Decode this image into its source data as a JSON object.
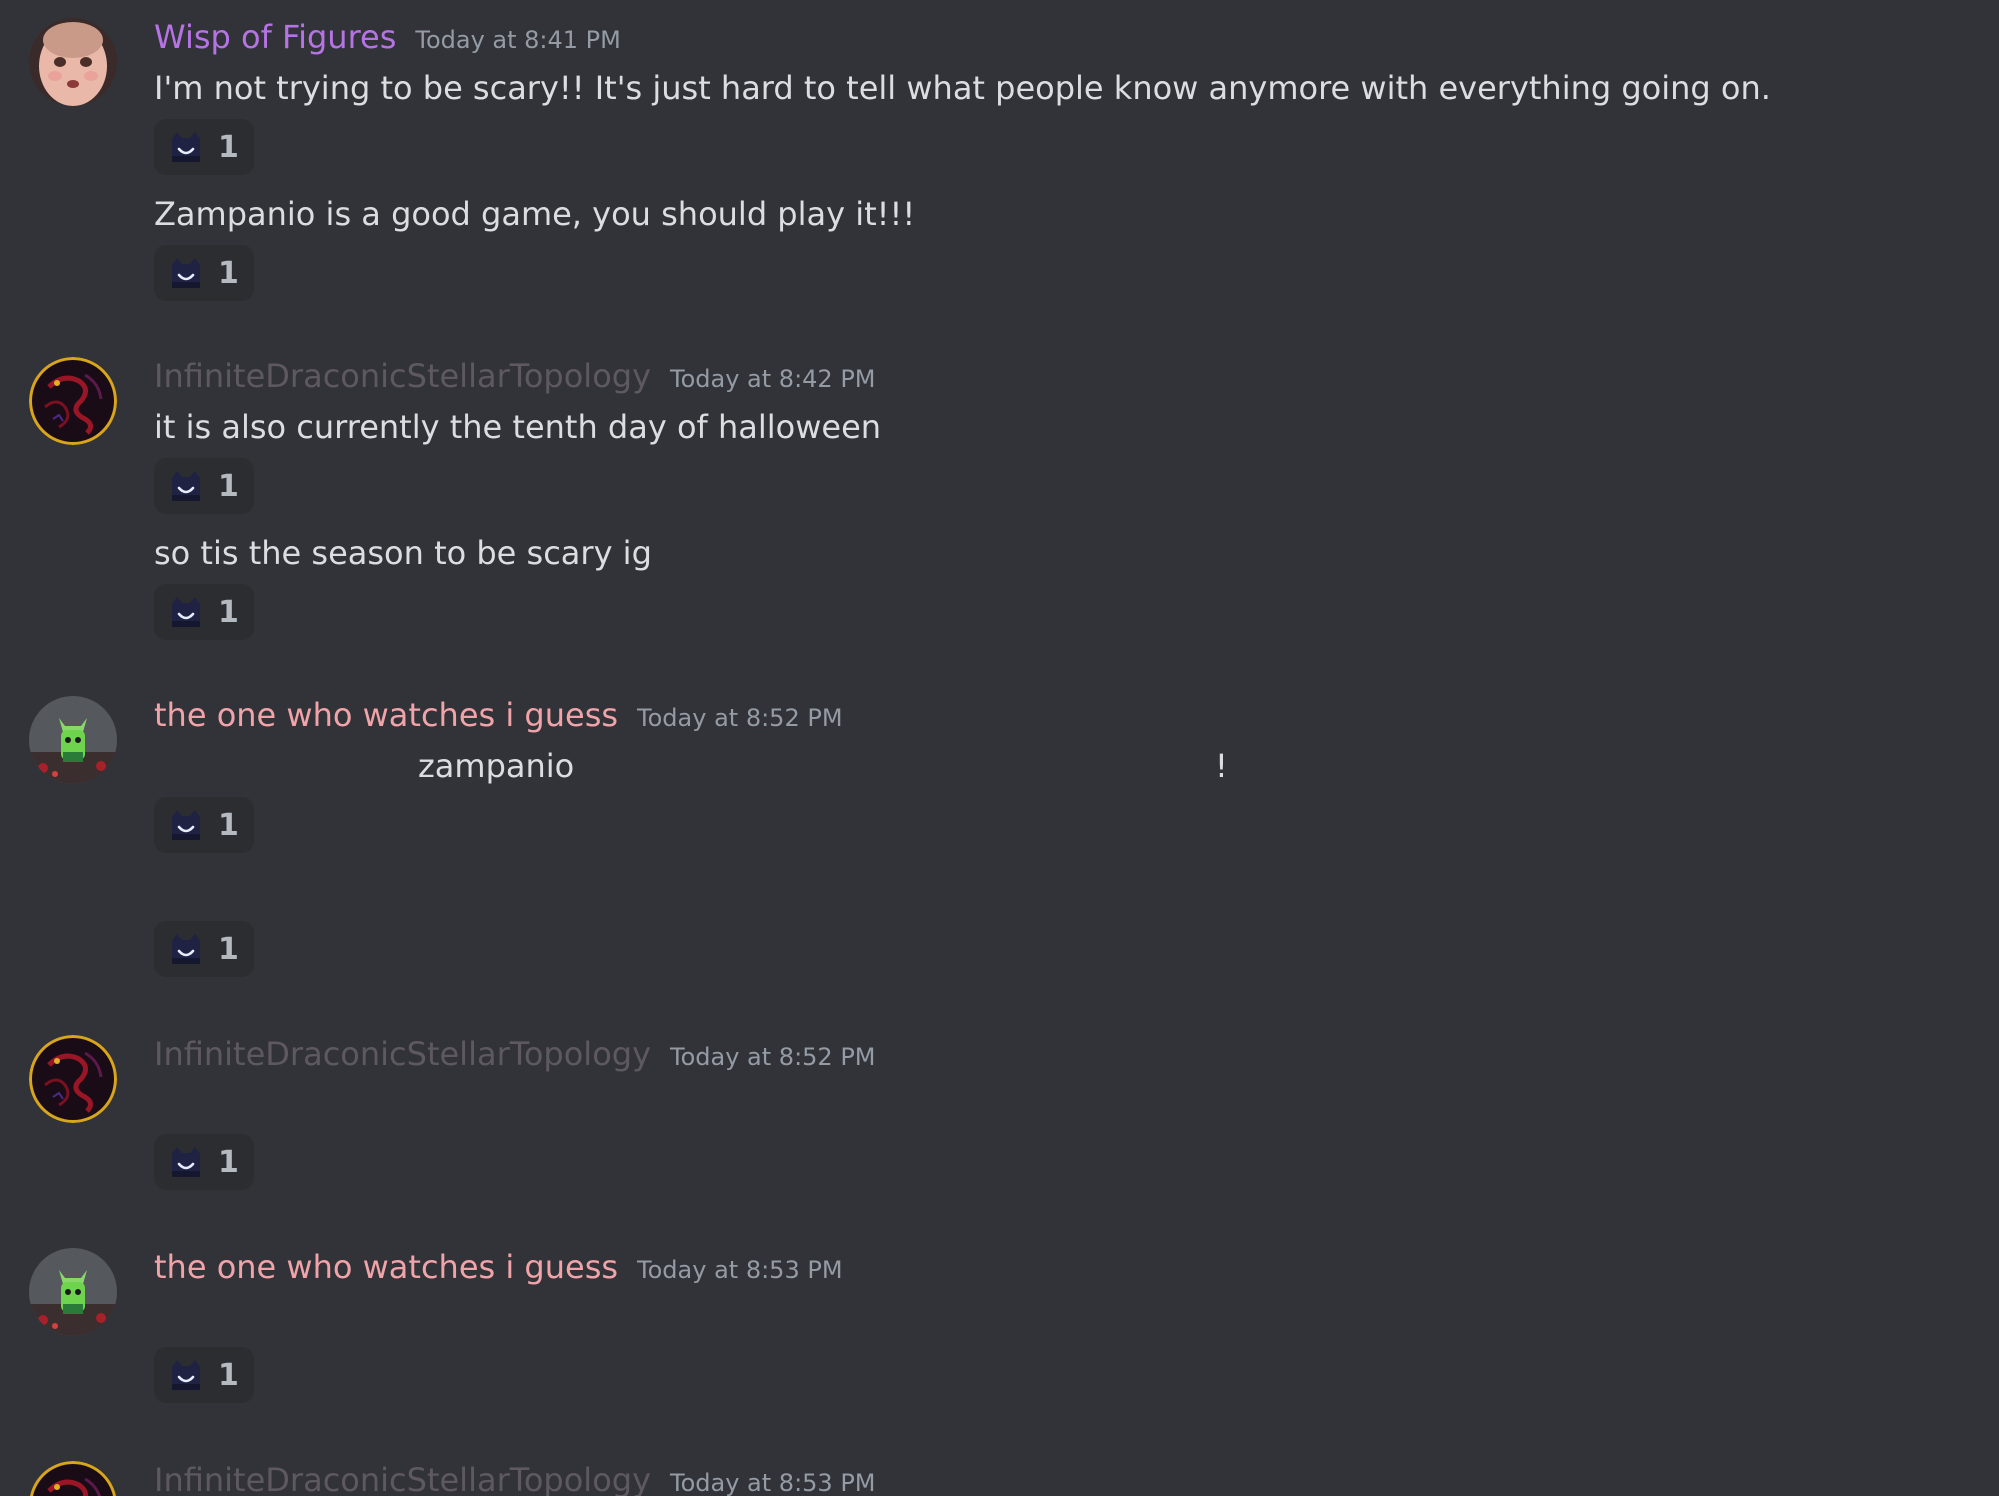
{
  "colors": {
    "background": "#313338",
    "reaction_bg": "#2b2d31",
    "wisp_name": "#b673e4",
    "draconic_name": "#5e5860",
    "watcher_name": "#f0a3a8",
    "timestamp": "#949ba4"
  },
  "groups": [
    {
      "username": "Wisp of Figures",
      "timestamp": "Today at 8:41 PM",
      "avatar_icon": "doll-face-avatar",
      "messages": [
        {
          "text": "I'm not trying to be scary!! It's just hard to tell what people know anymore with everything going on.",
          "reaction_icon": "hat-face-emoji",
          "reaction_count": "1"
        },
        {
          "text": "Zampanio is a good game, you should play it!!!",
          "reaction_icon": "hat-face-emoji",
          "reaction_count": "1"
        }
      ]
    },
    {
      "username": "InfiniteDraconicStellarTopology",
      "timestamp": "Today at 8:42 PM",
      "avatar_icon": "red-dragon-avatar",
      "messages": [
        {
          "text": "it is also currently the tenth day of halloween",
          "reaction_icon": "hat-face-emoji",
          "reaction_count": "1"
        },
        {
          "text": "so tis the season to be scary ig",
          "reaction_icon": "hat-face-emoji",
          "reaction_count": "1"
        }
      ]
    },
    {
      "username": "the one who watches i guess",
      "timestamp": "Today at 8:52 PM",
      "avatar_icon": "green-creature-avatar",
      "messages": [
        {
          "text_part1": "zampanio",
          "text_part2": "!",
          "reaction_icon": "hat-face-emoji",
          "reaction_count": "1"
        },
        {
          "reaction_icon": "hat-face-emoji",
          "reaction_count": "1"
        }
      ]
    },
    {
      "username": "InfiniteDraconicStellarTopology",
      "timestamp": "Today at 8:52 PM",
      "avatar_icon": "red-dragon-avatar",
      "messages": [
        {
          "reaction_icon": "hat-face-emoji",
          "reaction_count": "1"
        }
      ]
    },
    {
      "username": "the one who watches i guess",
      "timestamp": "Today at 8:53 PM",
      "avatar_icon": "green-creature-avatar",
      "messages": [
        {
          "reaction_icon": "hat-face-emoji",
          "reaction_count": "1"
        }
      ]
    },
    {
      "username": "InfiniteDraconicStellarTopology",
      "timestamp": "Today at 8:53 PM",
      "avatar_icon": "red-dragon-avatar",
      "messages": []
    }
  ]
}
